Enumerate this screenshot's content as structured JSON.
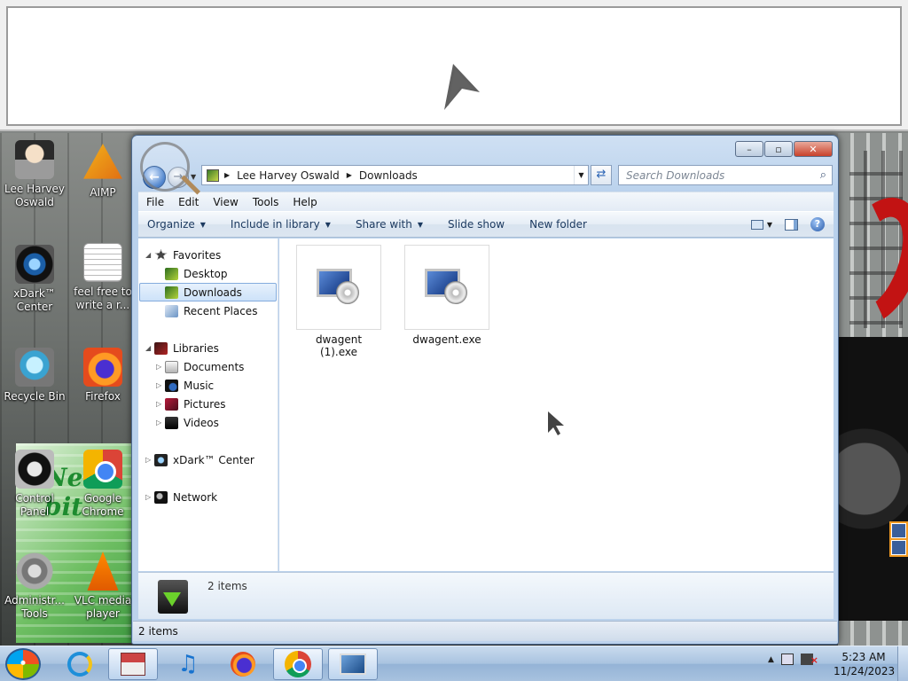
{
  "desktop": {
    "icons": [
      {
        "label": "Lee Harvey Oswald"
      },
      {
        "label": "AIMP"
      },
      {
        "label": "xDark™ Center"
      },
      {
        "label": "feel free to write a r..."
      },
      {
        "label": "Recycle Bin"
      },
      {
        "label": "Firefox"
      },
      {
        "label": "Control Panel"
      },
      {
        "label": "Google Chrome"
      },
      {
        "label": "Administr... Tools"
      },
      {
        "label": "VLC media player"
      }
    ],
    "box_art_text": "New bit"
  },
  "explorer": {
    "address": {
      "crumbs": [
        "Lee Harvey Oswald",
        "Downloads"
      ]
    },
    "search": {
      "placeholder": "Search Downloads"
    },
    "menu": [
      "File",
      "Edit",
      "View",
      "Tools",
      "Help"
    ],
    "commands": {
      "organize": "Organize",
      "include": "Include in library",
      "share": "Share with",
      "slideshow": "Slide show",
      "newfolder": "New folder"
    },
    "nav": {
      "favorites": "Favorites",
      "desktop": "Desktop",
      "downloads": "Downloads",
      "recent": "Recent Places",
      "libraries": "Libraries",
      "documents": "Documents",
      "music": "Music",
      "pictures": "Pictures",
      "videos": "Videos",
      "xdark": "xDark™ Center",
      "network": "Network"
    },
    "files": [
      {
        "name": "dwagent (1).exe"
      },
      {
        "name": "dwagent.exe"
      }
    ],
    "details_count": "2 items",
    "status": "2 items"
  },
  "taskbar": {
    "clock_time": "5:23 AM",
    "clock_date": "11/24/2023"
  },
  "colors": {
    "window_frame": "#bcd2ec",
    "command_bar_text": "#1c3a60",
    "close_button": "#c8412a"
  }
}
